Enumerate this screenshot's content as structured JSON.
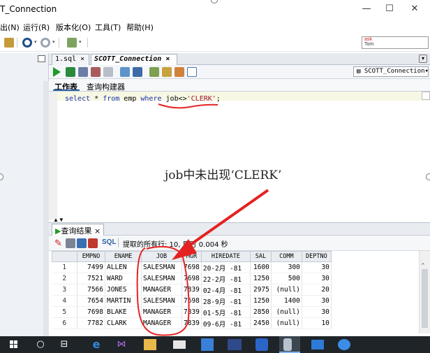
{
  "window": {
    "title": "T_Connection",
    "minimize": "—",
    "maximize": "☐",
    "close": "✕"
  },
  "menu": {
    "items": [
      "出(N)",
      "运行(R)",
      "版本化(O)",
      "工具(T)",
      "帮助(H)"
    ]
  },
  "toolbar_right": {
    "box_text_top": "ask",
    "box_text_bottom": "Tom"
  },
  "tabs": {
    "file_tab": "1.sql",
    "active_tab": "SCOTT_Connection",
    "close": "×"
  },
  "connection_selector": {
    "label": "SCOTT_Connection"
  },
  "subtabs": {
    "worksheet": "工作表",
    "query_builder": "查询构建器"
  },
  "editor": {
    "sql_select": "select",
    "sql_star": " * ",
    "sql_from": "from",
    "sql_table": " emp ",
    "sql_where": "where",
    "sql_space": " ",
    "sql_column": "job",
    "sql_op": "<>",
    "sql_value": "'CLERK'",
    "sql_end": ";"
  },
  "annotation": {
    "text": "job中未出现‘CLERK’"
  },
  "results": {
    "tab_label": "查询结果",
    "tab_close": "×",
    "sql_label": "SQL",
    "status": "提取的所有行: 10, 用时 0.004 秒",
    "columns": [
      "EMPNO",
      "ENAME",
      "JOB",
      "MGR",
      "HIREDATE",
      "SAL",
      "COMM",
      "DEPTNO"
    ],
    "rows": [
      {
        "n": "1",
        "empno": "7499",
        "ename": "ALLEN",
        "job": "SALESMAN",
        "mgr": "7698",
        "hiredate": "20-2月 -81",
        "sal": "1600",
        "comm": "300",
        "deptno": "30"
      },
      {
        "n": "2",
        "empno": "7521",
        "ename": "WARD",
        "job": "SALESMAN",
        "mgr": "7698",
        "hiredate": "22-2月 -81",
        "sal": "1250",
        "comm": "500",
        "deptno": "30"
      },
      {
        "n": "3",
        "empno": "7566",
        "ename": "JONES",
        "job": "MANAGER",
        "mgr": "7839",
        "hiredate": "02-4月 -81",
        "sal": "2975",
        "comm": "(null)",
        "deptno": "20"
      },
      {
        "n": "4",
        "empno": "7654",
        "ename": "MARTIN",
        "job": "SALESMAN",
        "mgr": "7698",
        "hiredate": "28-9月 -81",
        "sal": "1250",
        "comm": "1400",
        "deptno": "30"
      },
      {
        "n": "5",
        "empno": "7698",
        "ename": "BLAKE",
        "job": "MANAGER",
        "mgr": "7839",
        "hiredate": "01-5月 -81",
        "sal": "2850",
        "comm": "(null)",
        "deptno": "30"
      },
      {
        "n": "6",
        "empno": "7782",
        "ename": "CLARK",
        "job": "MANAGER",
        "mgr": "7839",
        "hiredate": "09-6月 -81",
        "sal": "2450",
        "comm": "(null)",
        "deptno": "10"
      }
    ]
  },
  "taskbar": {
    "search_glyph": "○",
    "taskview_glyph": "⊟",
    "edge_glyph": "e"
  }
}
